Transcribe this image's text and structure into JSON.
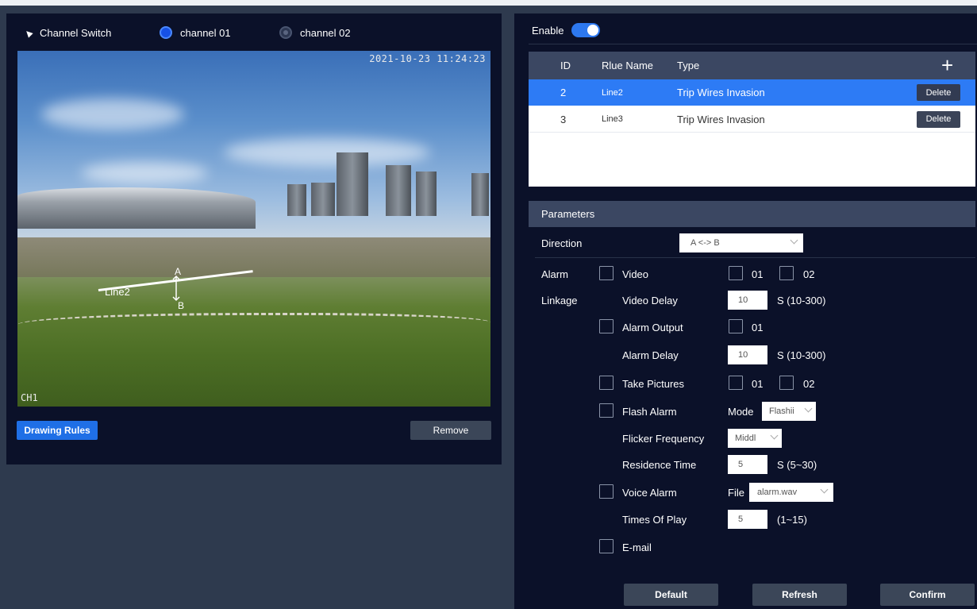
{
  "channel": {
    "switch_label": "Channel Switch",
    "ch1_label": "channel 01",
    "ch2_label": "channel 02",
    "selected": "channel 01"
  },
  "video": {
    "timestamp": "2021-10-23 11:24:23",
    "channel_overlay": "CH1",
    "rule_line_name": "Line2",
    "point_a": "A",
    "point_b": "B"
  },
  "buttons": {
    "drawing_rules": "Drawing Rules",
    "remove": "Remove",
    "default": "Default",
    "refresh": "Refresh",
    "confirm": "Confirm"
  },
  "enable": {
    "label": "Enable",
    "on": true
  },
  "rules_table": {
    "headers": {
      "id": "ID",
      "name": "Rlue Name",
      "type": "Type"
    },
    "add_icon": "plus-icon",
    "delete_label": "Delete",
    "rows": [
      {
        "id": "2",
        "name": "Line2",
        "type": "Trip Wires Invasion",
        "selected": true
      },
      {
        "id": "3",
        "name": "Line3",
        "type": "Trip Wires Invasion",
        "selected": false
      }
    ]
  },
  "params": {
    "title": "Parameters",
    "direction_label": "Direction",
    "direction_value": "A <-> B",
    "alarm_label": "Alarm",
    "linkage_label": "Linkage",
    "video_label": "Video",
    "video_ch1": "01",
    "video_ch2": "02",
    "video_delay_label": "Video Delay",
    "video_delay_value": "10",
    "video_delay_unit": "S  (10-300)",
    "alarm_output_label": "Alarm Output",
    "alarm_output_ch1": "01",
    "alarm_delay_label": "Alarm Delay",
    "alarm_delay_value": "10",
    "alarm_delay_unit": "S  (10-300)",
    "take_pictures_label": "Take Pictures",
    "take_pictures_ch1": "01",
    "take_pictures_ch2": "02",
    "flash_alarm_label": "Flash Alarm",
    "mode_label": "Mode",
    "mode_value": "Flashii",
    "flicker_label": "Flicker Frequency",
    "flicker_value": "Middl",
    "residence_label": "Residence Time",
    "residence_value": "5",
    "residence_unit": "S (5~30)",
    "voice_alarm_label": "Voice Alarm",
    "file_label": "File",
    "file_value": "alarm.wav",
    "times_label": "Times Of Play",
    "times_value": "5",
    "times_unit": "(1~15)",
    "email_label": "E-mail"
  }
}
